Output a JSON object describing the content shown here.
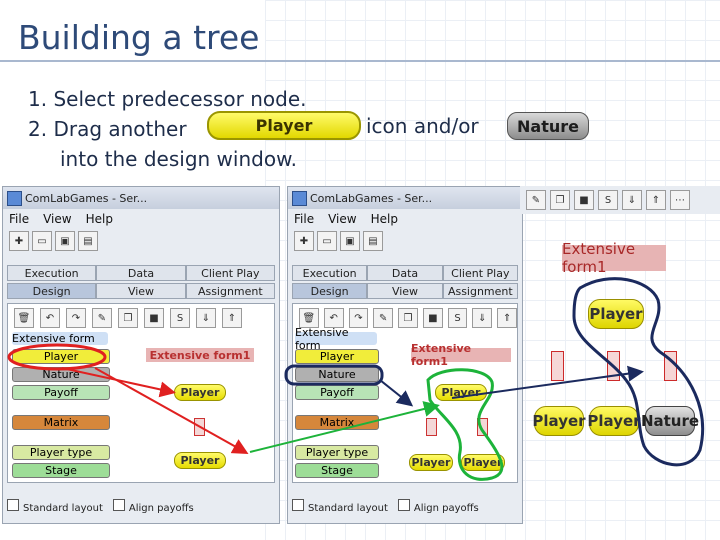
{
  "slide": {
    "title": "Building a tree",
    "steps": [
      "1. Select predecessor node.",
      "2. Drag another",
      "into the design window."
    ],
    "step2_suffix": "icon and/or",
    "inline_player_label": "Player",
    "inline_nature_label": "Nature"
  },
  "window_left": {
    "title": "ComLabGames - Ser...",
    "menu": [
      "File",
      "View",
      "Help"
    ],
    "tabs_row1": [
      "Execution",
      "Data",
      "Client Play"
    ],
    "tabs_row2": [
      "Design",
      "View",
      "Assignment"
    ],
    "palette": {
      "header": "Extensive form",
      "items": [
        "Player",
        "Nature",
        "Payoff",
        "Matrix",
        "Player type",
        "Stage"
      ]
    },
    "canvas": {
      "root": "Extensive form1",
      "nodes": [
        "Player",
        "Player"
      ]
    },
    "status": {
      "standard_layout": "Standard layout",
      "align_payoffs": "Align payoffs"
    }
  },
  "window_right": {
    "title": "ComLabGames - Ser...",
    "menu": [
      "File",
      "View",
      "Help"
    ],
    "tabs_row1": [
      "Execution",
      "Data",
      "Client Play"
    ],
    "tabs_row2": [
      "Design",
      "View",
      "Assignment"
    ],
    "palette": {
      "header": "Extensive form",
      "items": [
        "Player",
        "Nature",
        "Payoff",
        "Matrix",
        "Player type",
        "Stage"
      ]
    },
    "canvas": {
      "root": "Extensive form1",
      "nodes": [
        "Player",
        "Player",
        "Player"
      ]
    },
    "status": {
      "standard_layout": "Standard layout",
      "align_payoffs": "Align payoffs"
    }
  },
  "big_view": {
    "root": "Extensive form1",
    "top": "Player",
    "leaves": [
      "Player",
      "Player",
      "Nature"
    ]
  },
  "toolbar_icons": {
    "s_button": "S"
  },
  "colors": {
    "title": "#2e4a78",
    "player_yellow": "#f1ed3a",
    "nature_gray": "#8c8c8c",
    "highlight_red": "#e02020",
    "highlight_green": "#1db33a",
    "highlight_navy": "#1b2a5e"
  }
}
